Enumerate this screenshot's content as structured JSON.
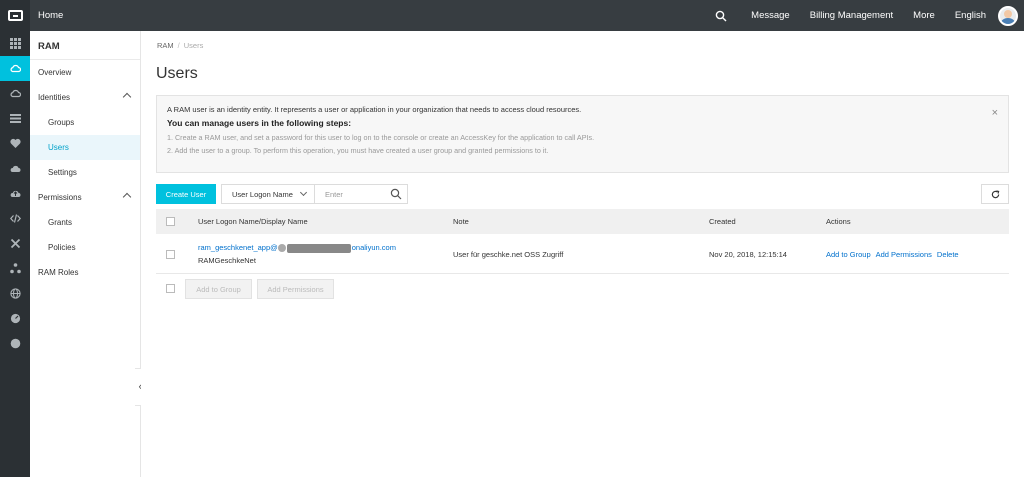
{
  "topbar": {
    "home": "Home",
    "nav": [
      "Message",
      "Billing Management",
      "More",
      "English"
    ]
  },
  "sidebar": {
    "title": "RAM",
    "items": [
      {
        "label": "Overview"
      },
      {
        "label": "Identities"
      },
      {
        "label": "Groups"
      },
      {
        "label": "Users"
      },
      {
        "label": "Settings"
      },
      {
        "label": "Permissions"
      },
      {
        "label": "Grants"
      },
      {
        "label": "Policies"
      },
      {
        "label": "RAM Roles"
      }
    ],
    "collapse_glyph": "«"
  },
  "breadcrumb": {
    "root": "RAM",
    "sep": "/",
    "current": "Users"
  },
  "page": {
    "title": "Users"
  },
  "info": {
    "intro": "A RAM user is an identity entity. It represents a user or application in your organization that needs to access cloud resources.",
    "heading": "You can manage users in the following steps:",
    "step1": "1. Create a RAM user, and set a password for this user to log on to the console or create an AccessKey for the application to call APIs.",
    "step2": "2. Add the user to a group. To perform this operation, you must have created a user group and granted permissions to it.",
    "close": "×"
  },
  "toolbar": {
    "create_label": "Create User",
    "filter_selected": "User Logon Name",
    "search_placeholder": "Enter"
  },
  "table": {
    "headers": [
      "User Logon Name/Display Name",
      "Note",
      "Created",
      "Actions"
    ],
    "rows": [
      {
        "logon_prefix": "ram_geschkenet_app@",
        "logon_suffix": "onaliyun.com",
        "display": "RAMGeschkeNet",
        "note": "User für geschke.net OSS Zugriff",
        "created": "Nov 20, 2018, 12:15:14",
        "actions": [
          "Add to Group",
          "Add Permissions",
          "Delete"
        ]
      }
    ]
  },
  "bulk": {
    "add_group": "Add to Group",
    "add_permissions": "Add Permissions"
  },
  "colors": {
    "accent": "#00c1de",
    "link": "#0070cc",
    "topbar": "#373d41",
    "rail": "#2b3034"
  }
}
